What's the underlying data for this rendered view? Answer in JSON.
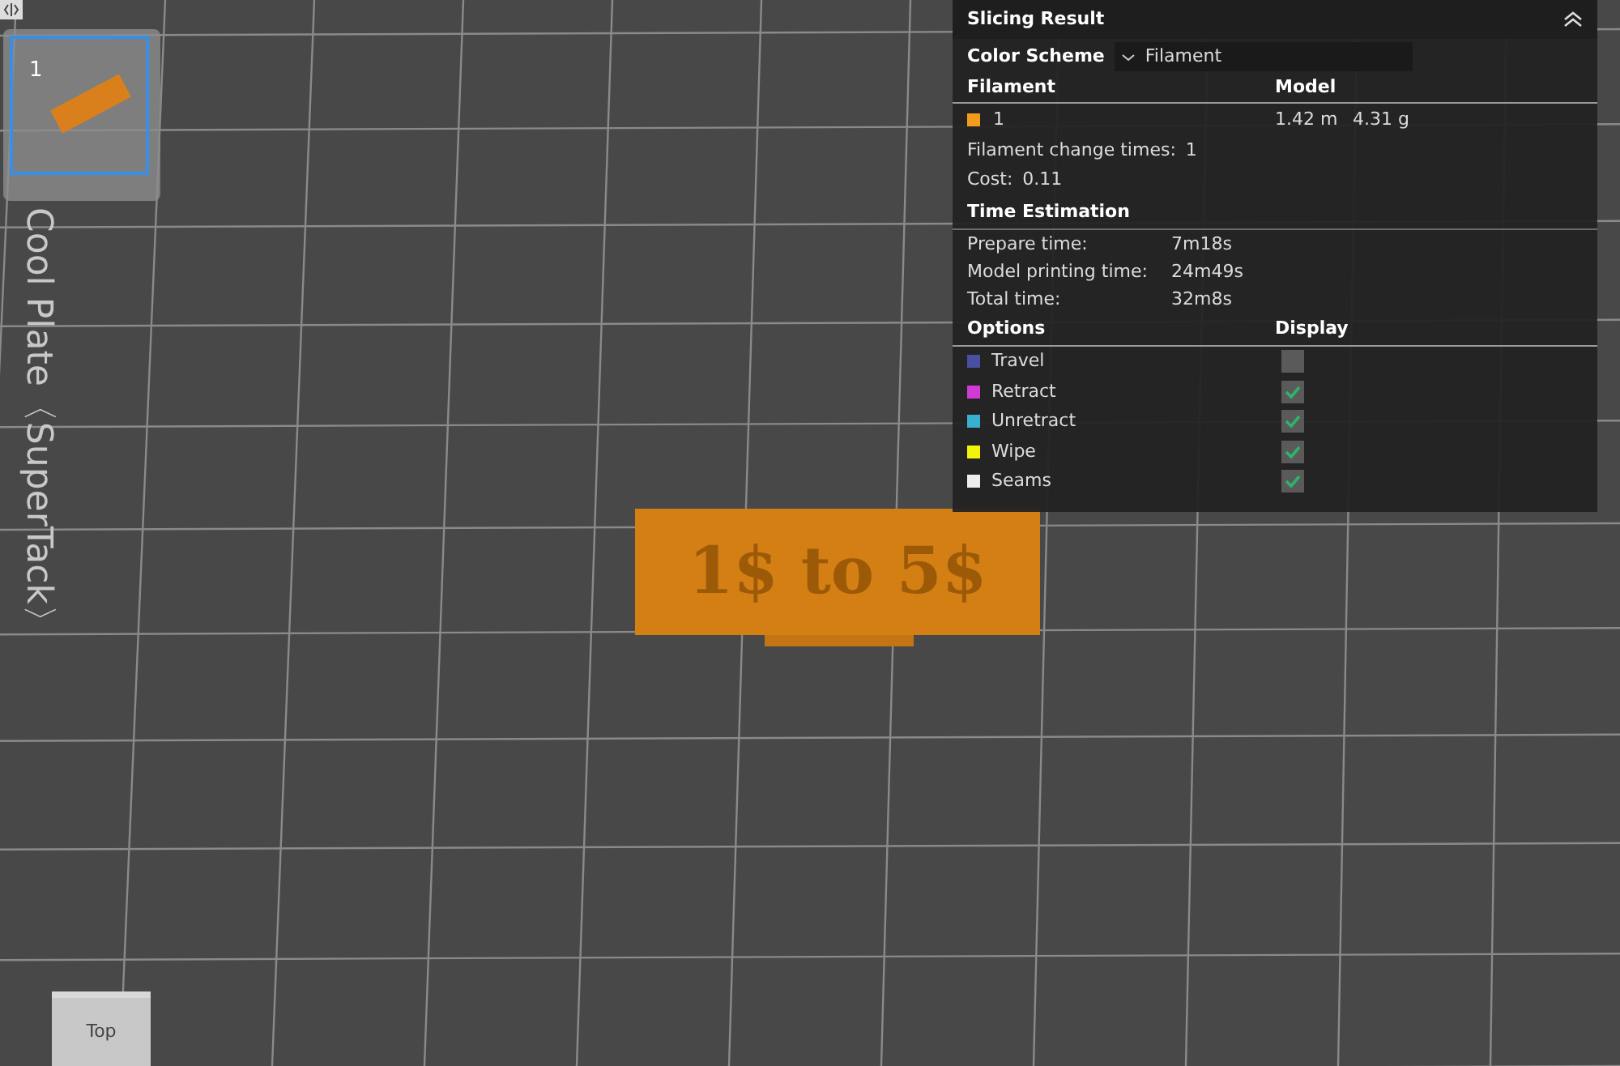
{
  "plates": [
    {
      "label": "1",
      "selected": true
    }
  ],
  "bed_label": "Cool Plate〈SuperTack〉",
  "model_label": "1$ to 5$",
  "view_cube": {
    "label": "Top"
  },
  "panel": {
    "title": "Slicing Result",
    "color_scheme": {
      "label": "Color Scheme",
      "value": "Filament"
    },
    "filament_header": {
      "column_1": "Filament",
      "column_2": "Model"
    },
    "filaments": [
      {
        "color": "#f39c1b",
        "name": "1",
        "length": "1.42 m",
        "weight": "4.31 g"
      }
    ],
    "stats": [
      {
        "label": "Filament change times:",
        "value": "1"
      },
      {
        "label": "Cost:",
        "value": "0.11"
      }
    ],
    "time_title": "Time Estimation",
    "times": [
      {
        "label": "Prepare time:",
        "value": "7m18s"
      },
      {
        "label": "Model printing time:",
        "value": "24m49s"
      },
      {
        "label": "Total time:",
        "value": "32m8s"
      }
    ],
    "options_header": {
      "column_1": "Options",
      "column_2": "Display"
    },
    "options": [
      {
        "name": "Travel",
        "color": "#4a4fa0",
        "checked": false
      },
      {
        "name": "Retract",
        "color": "#d23ad6",
        "checked": true
      },
      {
        "name": "Unretract",
        "color": "#3ab0d0",
        "checked": true
      },
      {
        "name": "Wipe",
        "color": "#f2f20a",
        "checked": true
      },
      {
        "name": "Seams",
        "color": "#eeeeee",
        "checked": true
      }
    ]
  }
}
